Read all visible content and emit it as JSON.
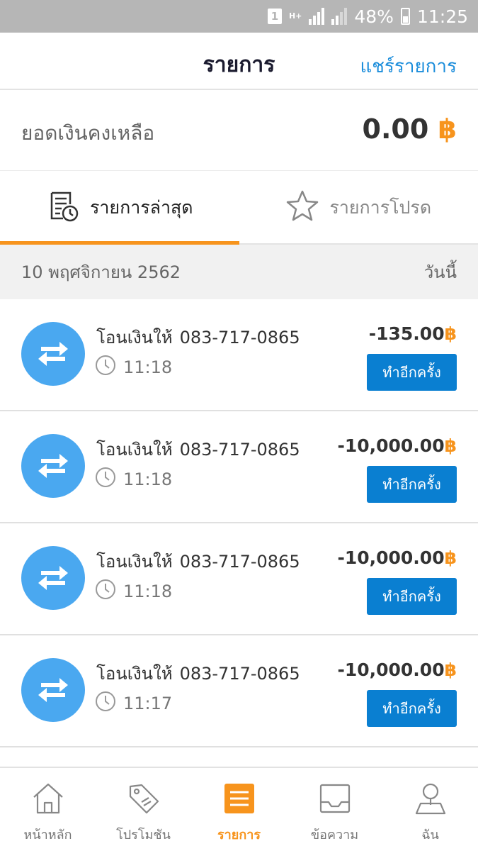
{
  "status_bar": {
    "sim": "1",
    "network_type": "H+",
    "battery": "48%",
    "time": "11:25"
  },
  "header": {
    "title": "รายการ",
    "action": "แชร์รายการ"
  },
  "balance": {
    "label": "ยอดเงินคงเหลือ",
    "amount": "0.00",
    "currency": "฿"
  },
  "tabs": [
    {
      "label": "รายการล่าสุด",
      "icon": "recent-list-icon",
      "active": true
    },
    {
      "label": "รายการโปรด",
      "icon": "star-icon",
      "active": false
    }
  ],
  "date_bar": {
    "date": "10 พฤศจิกายน 2562",
    "relative": "วันนี้"
  },
  "transactions": [
    {
      "title": "โอนเงินให้",
      "account": "083-717-0865",
      "time": "11:18",
      "amount": "-135.00",
      "currency": "฿",
      "action": "ทำอีกครั้ง",
      "icon": "transfer-icon"
    },
    {
      "title": "โอนเงินให้",
      "account": "083-717-0865",
      "time": "11:18",
      "amount": "-10,000.00",
      "currency": "฿",
      "action": "ทำอีกครั้ง",
      "icon": "transfer-icon"
    },
    {
      "title": "โอนเงินให้",
      "account": "083-717-0865",
      "time": "11:18",
      "amount": "-10,000.00",
      "currency": "฿",
      "action": "ทำอีกครั้ง",
      "icon": "transfer-icon"
    },
    {
      "title": "โอนเงินให้",
      "account": "083-717-0865",
      "time": "11:17",
      "amount": "-10,000.00",
      "currency": "฿",
      "action": "ทำอีกครั้ง",
      "icon": "transfer-icon"
    }
  ],
  "bottom_nav": [
    {
      "label": "หน้าหลัก",
      "icon": "home-icon",
      "active": false
    },
    {
      "label": "โปรโมชัน",
      "icon": "tag-icon",
      "active": false
    },
    {
      "label": "รายการ",
      "icon": "list-icon",
      "active": true
    },
    {
      "label": "ข้อความ",
      "icon": "inbox-icon",
      "active": false
    },
    {
      "label": "ฉัน",
      "icon": "profile-icon",
      "active": false
    }
  ],
  "colors": {
    "accent": "#f7941d",
    "primary_blue": "#0a7fd1",
    "avatar_blue": "#4aa8f0",
    "link_blue": "#1b8ddb"
  }
}
